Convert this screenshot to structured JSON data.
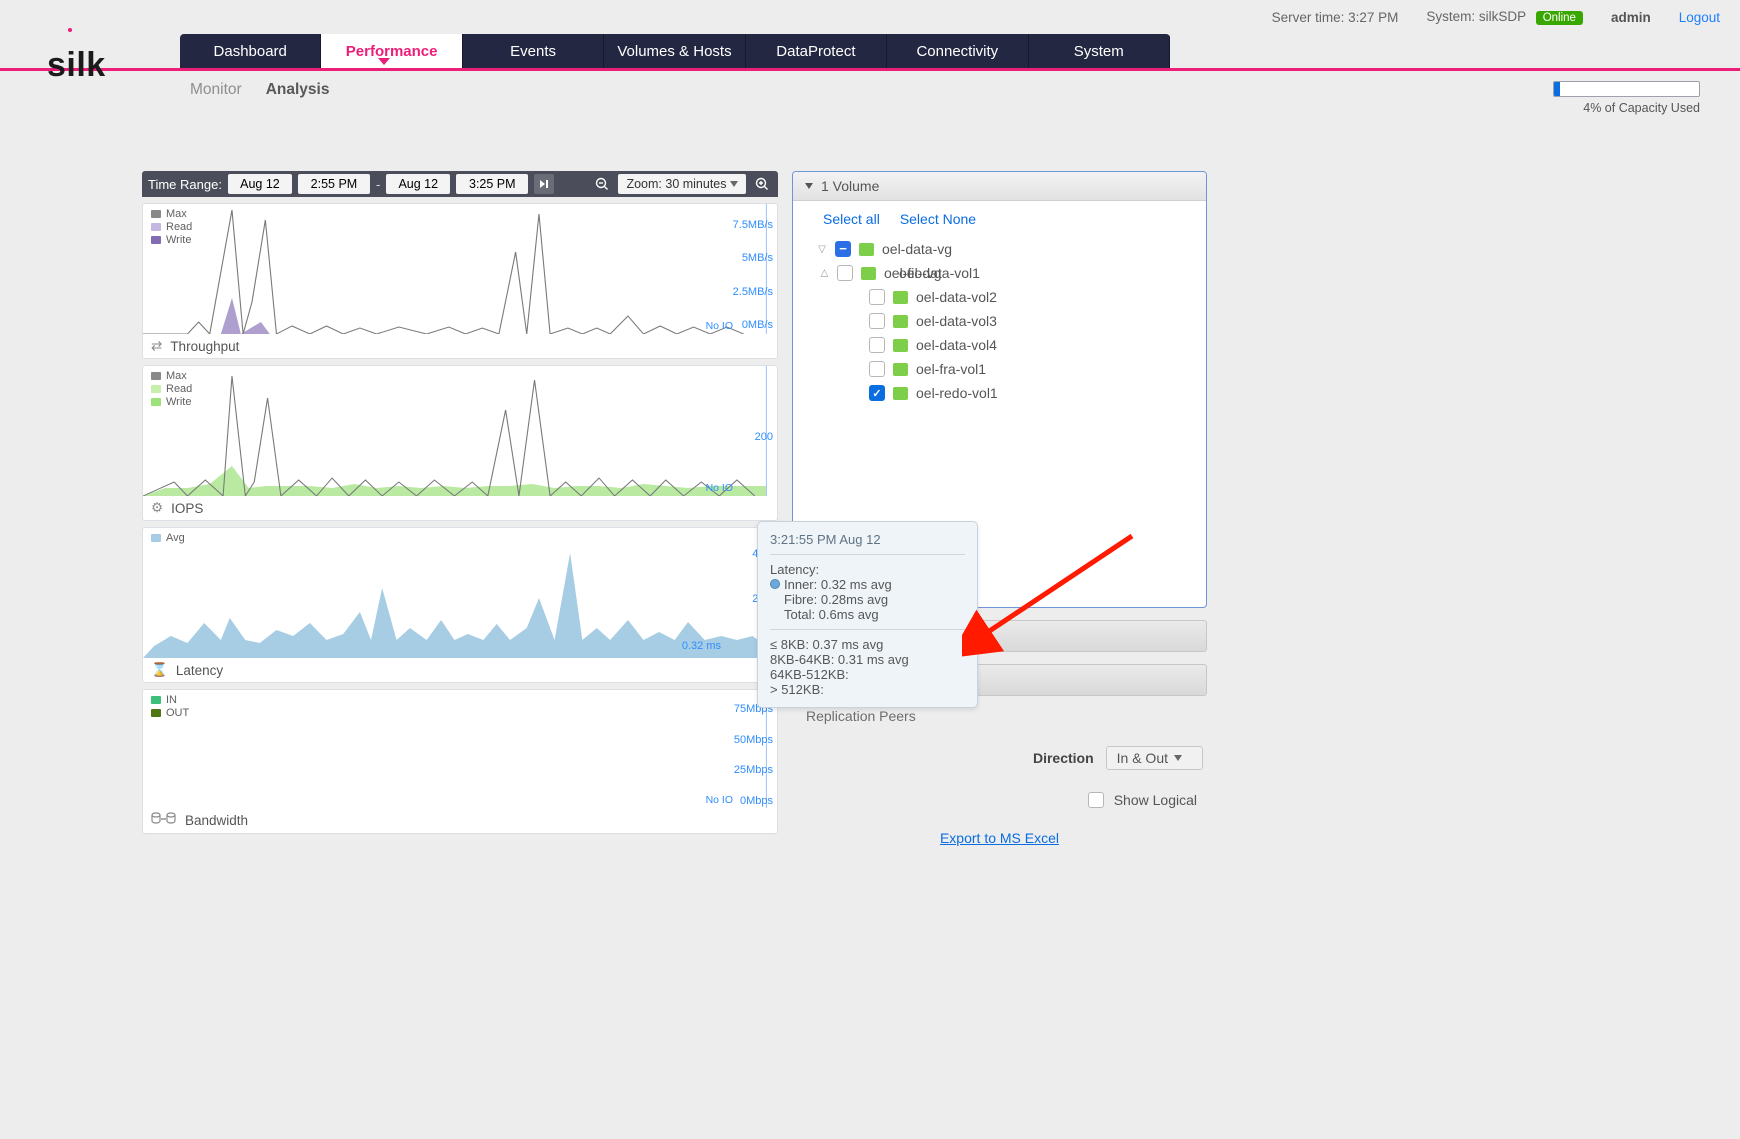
{
  "topbar": {
    "server_time_label": "Server time: 3:27 PM",
    "system_label": "System: silkSDP",
    "online_badge": "Online",
    "admin": "admin",
    "logout": "Logout"
  },
  "logo": "silk",
  "nav": [
    "Dashboard",
    "Performance",
    "Events",
    "Volumes & Hosts",
    "DataProtect",
    "Connectivity",
    "System"
  ],
  "nav_active": 1,
  "subnav": {
    "items": [
      "Monitor",
      "Analysis"
    ],
    "active": 1
  },
  "capacity": {
    "pct": 4,
    "label": "4% of Capacity Used"
  },
  "toolbar": {
    "range_label": "Time Range:",
    "from_date": "Aug 12",
    "from_time": "2:55 PM",
    "to_date": "Aug 12",
    "to_time": "3:25 PM",
    "zoom": "Zoom: 30 minutes"
  },
  "charts": {
    "throughput": {
      "title": "Throughput",
      "legend": [
        "Max",
        "Read",
        "Write"
      ],
      "yticks": [
        "7.5MB/s",
        "5MB/s",
        "2.5MB/s",
        "0MB/s"
      ],
      "noio": "No IO"
    },
    "iops": {
      "title": "IOPS",
      "legend": [
        "Max",
        "Read",
        "Write"
      ],
      "yticks": [
        "200"
      ],
      "noio": "No IO"
    },
    "latency": {
      "title": "Latency",
      "legend": [
        "Avg"
      ],
      "yticks": [
        "4ms",
        "2ms",
        "0"
      ],
      "value_tag": "0.32 ms"
    },
    "bandwidth": {
      "title": "Bandwidth",
      "legend": [
        "IN",
        "OUT"
      ],
      "yticks": [
        "75Mbps",
        "50Mbps",
        "25Mbps",
        "0Mbps"
      ],
      "noio": "No IO"
    }
  },
  "side": {
    "header": "1 Volume",
    "select_all": "Select all",
    "select_none": "Select None",
    "tree": {
      "group": "oel-data-vg",
      "group_child": "oel-fio-vg",
      "overlap": "oel-data-vol1",
      "children": [
        {
          "label": "oel-data-vol2",
          "checked": false
        },
        {
          "label": "oel-data-vol3",
          "checked": false
        },
        {
          "label": "oel-data-vol4",
          "checked": false
        },
        {
          "label": "oel-fra-vol1",
          "checked": false
        },
        {
          "label": "oel-redo-vol1",
          "checked": true
        }
      ]
    },
    "rep_peers": "Replication Peers",
    "direction_label": "Direction",
    "direction_value": "In & Out",
    "show_logical": "Show Logical",
    "export": "Export to MS Excel"
  },
  "tooltip": {
    "ts": "3:21:55 PM Aug 12",
    "latency_label": "Latency:",
    "inner": "Inner: 0.32 ms avg",
    "fibre": "Fibre: 0.28ms avg",
    "total": "Total: 0.6ms avg",
    "b1": "≤ 8KB: 0.37 ms avg",
    "b2": "8KB-64KB: 0.31 ms avg",
    "b3": "64KB-512KB:",
    "b4": "> 512KB:"
  },
  "chart_data": [
    {
      "type": "line",
      "title": "Throughput",
      "ylabel": "MB/s",
      "ylim": [
        0,
        8
      ],
      "series": [
        {
          "name": "Max",
          "values": [
            0,
            0,
            0.8,
            8,
            2,
            0.5,
            3.5,
            0,
            0.6,
            0,
            0.6,
            0,
            0,
            0.6,
            0,
            0,
            0.6,
            0,
            0.7,
            4.5,
            0,
            7.2,
            0,
            0,
            0.5,
            0.5,
            0.8,
            0,
            0.7,
            0,
            0.7,
            0,
            0.5,
            0
          ]
        },
        {
          "name": "Read",
          "values": [
            0,
            0,
            0,
            2,
            0,
            0,
            1.5,
            0,
            0,
            0,
            0,
            0,
            0,
            0,
            0,
            0,
            0,
            0,
            0,
            0,
            0,
            0,
            0,
            0,
            0,
            0,
            0,
            0,
            0,
            0,
            0,
            0,
            0,
            0
          ]
        },
        {
          "name": "Write",
          "values": [
            0,
            0,
            0,
            2,
            0.2,
            0,
            1.2,
            0,
            0,
            0,
            0,
            0,
            0,
            0,
            0,
            0,
            0,
            0,
            0,
            0,
            0,
            0,
            0,
            0,
            0,
            0,
            0,
            0,
            0,
            0,
            0,
            0,
            0,
            0
          ]
        }
      ]
    },
    {
      "type": "line",
      "title": "IOPS",
      "ylabel": "IOPS",
      "ylim": [
        0,
        400
      ],
      "series": [
        {
          "name": "Max",
          "values": [
            0,
            40,
            40,
            360,
            40,
            40,
            300,
            35,
            40,
            35,
            40,
            35,
            35,
            40,
            35,
            40,
            40,
            35,
            40,
            260,
            35,
            330,
            35,
            40,
            35,
            40,
            40,
            35,
            40,
            35,
            35,
            35,
            40,
            35
          ]
        },
        {
          "name": "Read",
          "values": [
            0,
            10,
            10,
            40,
            10,
            10,
            10,
            10,
            10,
            10,
            10,
            10,
            10,
            10,
            10,
            10,
            10,
            10,
            10,
            30,
            10,
            30,
            10,
            10,
            10,
            10,
            10,
            10,
            10,
            10,
            10,
            10,
            10,
            10
          ]
        },
        {
          "name": "Write",
          "values": [
            0,
            28,
            28,
            90,
            28,
            28,
            35,
            28,
            28,
            28,
            28,
            28,
            28,
            28,
            28,
            28,
            28,
            28,
            28,
            45,
            28,
            45,
            28,
            28,
            28,
            28,
            28,
            28,
            28,
            28,
            28,
            28,
            28,
            28
          ]
        }
      ]
    },
    {
      "type": "area",
      "title": "Latency",
      "ylabel": "ms",
      "ylim": [
        0,
        4
      ],
      "series": [
        {
          "name": "Avg",
          "values": [
            0.3,
            0.5,
            0.9,
            0.6,
            1.0,
            0.5,
            0.7,
            0.8,
            0.4,
            1.1,
            0.7,
            0.8,
            0.5,
            1.6,
            0.8,
            0.5,
            0.8,
            0.5,
            0.4,
            1.2,
            0.6,
            1.0,
            0.5,
            2.8,
            0.6,
            0.7,
            0.9,
            0.4,
            0.5,
            0.7,
            0.6,
            0.5,
            0.4,
            0.32
          ]
        }
      ]
    },
    {
      "type": "area",
      "title": "Bandwidth",
      "ylabel": "Mbps",
      "ylim": [
        0,
        100
      ],
      "series": [
        {
          "name": "IN",
          "values": []
        },
        {
          "name": "OUT",
          "values": []
        }
      ]
    }
  ]
}
